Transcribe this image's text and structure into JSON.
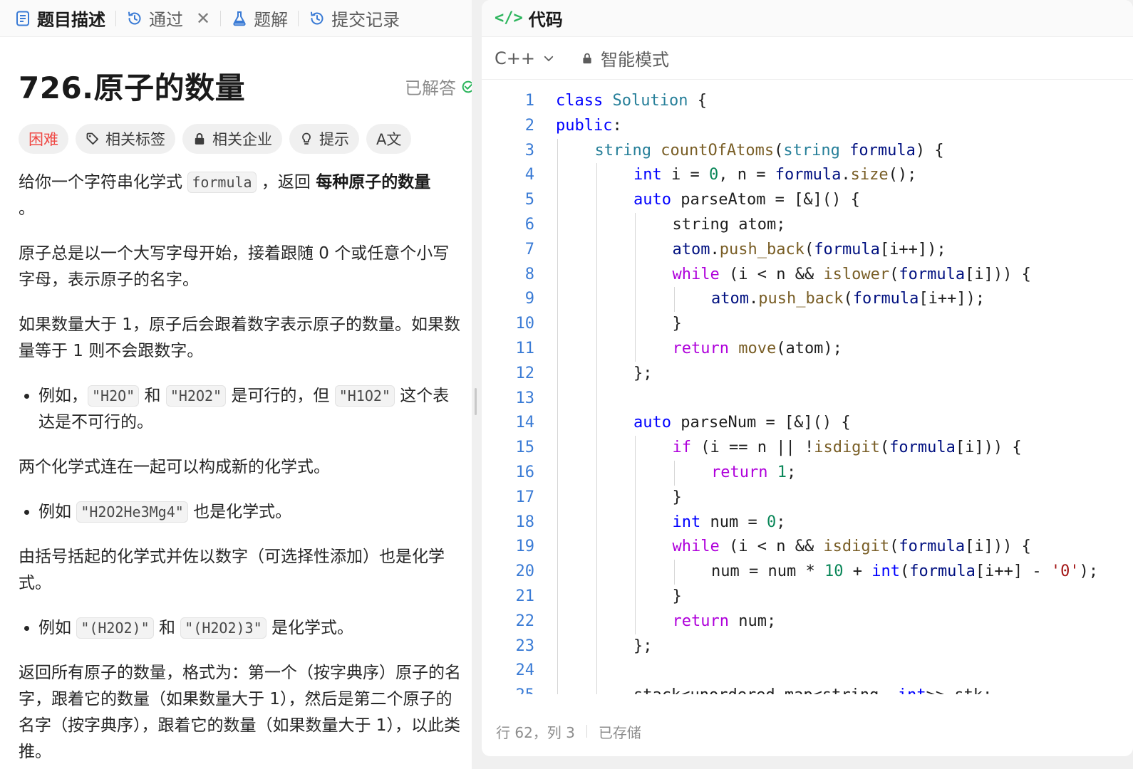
{
  "left_tabs": [
    {
      "label": "题目描述",
      "icon": "description-icon",
      "active": true
    },
    {
      "label": "通过",
      "icon": "history-icon",
      "closable": true
    },
    {
      "label": "题解",
      "icon": "flask-icon"
    },
    {
      "label": "提交记录",
      "icon": "history-icon"
    }
  ],
  "close_glyph": "✕",
  "problem": {
    "title": "726.原子的数量",
    "status": "已解答",
    "tags": [
      "困难",
      "相关标签",
      "相关企业",
      "提示",
      "A文"
    ],
    "para1_prefix": "给你一个字符串化学式 ",
    "para1_code": "formula",
    "para1_mid": " ，返回 ",
    "para1_bold": "每种原子的数量",
    "para1_end": " 。",
    "para2": "原子总是以一个大写字母开始，接着跟随 0 个或任意个小写字母，表示原子的名字。",
    "para3": "如果数量大于 1，原子后会跟着数字表示原子的数量。如果数量等于 1 则不会跟数字。",
    "bullet1_a": "例如，",
    "bullet1_code1": "\"H2O\"",
    "bullet1_b": " 和 ",
    "bullet1_code2": "\"H2O2\"",
    "bullet1_c": " 是可行的，但 ",
    "bullet1_code3": "\"H1O2\"",
    "bullet1_d": " 这个表达是不可行的。",
    "para4": "两个化学式连在一起可以构成新的化学式。",
    "bullet2_a": "例如 ",
    "bullet2_code": "\"H2O2He3Mg4\"",
    "bullet2_b": " 也是化学式。",
    "para5": "由括号括起的化学式并佐以数字（可选择性添加）也是化学式。",
    "bullet3_a": "例如 ",
    "bullet3_code1": "\"(H2O2)\"",
    "bullet3_b": " 和 ",
    "bullet3_code2": "\"(H2O2)3\"",
    "bullet3_c": " 是化学式。",
    "para6": "返回所有原子的数量，格式为：第一个（按字典序）原子的名字，跟着它的数量（如果数量大于 1），然后是第二个原子的名字（按字典序），跟着它的数量（如果数量大于 1），以此类推。"
  },
  "code_panel": {
    "icon_glyph": "</>",
    "title": "代码",
    "language": "C++",
    "mode": "智能模式",
    "status_position": "行 62，列 3",
    "status_saved": "已存储"
  },
  "code_lines": [
    {
      "n": "1",
      "indent": 0,
      "tokens": [
        [
          "kw",
          "class "
        ],
        [
          "ty",
          "Solution"
        ],
        [
          "pl",
          " {"
        ]
      ]
    },
    {
      "n": "2",
      "indent": 0,
      "tokens": [
        [
          "kw",
          "public"
        ],
        [
          "pl",
          ":"
        ]
      ]
    },
    {
      "n": "3",
      "indent": 1,
      "tokens": [
        [
          "ty",
          "string "
        ],
        [
          "fn",
          "countOfAtoms"
        ],
        [
          "pl",
          "("
        ],
        [
          "ty",
          "string "
        ],
        [
          "vr",
          "formula"
        ],
        [
          "pl",
          ") {"
        ]
      ]
    },
    {
      "n": "4",
      "indent": 2,
      "tokens": [
        [
          "kw",
          "int "
        ],
        [
          "pl",
          "i = "
        ],
        [
          "nm",
          "0"
        ],
        [
          "pl",
          ", n = "
        ],
        [
          "vr",
          "formula"
        ],
        [
          "pl",
          "."
        ],
        [
          "fn",
          "size"
        ],
        [
          "pl",
          "();"
        ]
      ]
    },
    {
      "n": "5",
      "indent": 2,
      "tokens": [
        [
          "kw",
          "auto "
        ],
        [
          "pl",
          "parseAtom = [&]() {"
        ]
      ]
    },
    {
      "n": "6",
      "indent": 3,
      "tokens": [
        [
          "pl",
          "string atom;"
        ]
      ]
    },
    {
      "n": "7",
      "indent": 3,
      "tokens": [
        [
          "vr",
          "atom"
        ],
        [
          "pl",
          "."
        ],
        [
          "fn",
          "push_back"
        ],
        [
          "pl",
          "("
        ],
        [
          "vr",
          "formula"
        ],
        [
          "pl",
          "[i++]);"
        ]
      ]
    },
    {
      "n": "8",
      "indent": 3,
      "tokens": [
        [
          "kw2",
          "while "
        ],
        [
          "pl",
          "(i < n && "
        ],
        [
          "fn",
          "islower"
        ],
        [
          "pl",
          "("
        ],
        [
          "vr",
          "formula"
        ],
        [
          "pl",
          "[i])) {"
        ]
      ]
    },
    {
      "n": "9",
      "indent": 4,
      "tokens": [
        [
          "vr",
          "atom"
        ],
        [
          "pl",
          "."
        ],
        [
          "fn",
          "push_back"
        ],
        [
          "pl",
          "("
        ],
        [
          "vr",
          "formula"
        ],
        [
          "pl",
          "[i++]);"
        ]
      ]
    },
    {
      "n": "10",
      "indent": 3,
      "tokens": [
        [
          "pl",
          "}"
        ]
      ]
    },
    {
      "n": "11",
      "indent": 3,
      "tokens": [
        [
          "kw2",
          "return "
        ],
        [
          "fn",
          "move"
        ],
        [
          "pl",
          "(atom);"
        ]
      ]
    },
    {
      "n": "12",
      "indent": 2,
      "tokens": [
        [
          "pl",
          "};"
        ]
      ]
    },
    {
      "n": "13",
      "indent": 0,
      "tokens": []
    },
    {
      "n": "14",
      "indent": 2,
      "tokens": [
        [
          "kw",
          "auto "
        ],
        [
          "pl",
          "parseNum = [&]() {"
        ]
      ]
    },
    {
      "n": "15",
      "indent": 3,
      "tokens": [
        [
          "kw2",
          "if "
        ],
        [
          "pl",
          "(i == n || !"
        ],
        [
          "fn",
          "isdigit"
        ],
        [
          "pl",
          "("
        ],
        [
          "vr",
          "formula"
        ],
        [
          "pl",
          "[i])) {"
        ]
      ]
    },
    {
      "n": "16",
      "indent": 4,
      "tokens": [
        [
          "kw2",
          "return "
        ],
        [
          "nm",
          "1"
        ],
        [
          "pl",
          ";"
        ]
      ]
    },
    {
      "n": "17",
      "indent": 3,
      "tokens": [
        [
          "pl",
          "}"
        ]
      ]
    },
    {
      "n": "18",
      "indent": 3,
      "tokens": [
        [
          "kw",
          "int "
        ],
        [
          "pl",
          "num = "
        ],
        [
          "nm",
          "0"
        ],
        [
          "pl",
          ";"
        ]
      ]
    },
    {
      "n": "19",
      "indent": 3,
      "tokens": [
        [
          "kw2",
          "while "
        ],
        [
          "pl",
          "(i < n && "
        ],
        [
          "fn",
          "isdigit"
        ],
        [
          "pl",
          "("
        ],
        [
          "vr",
          "formula"
        ],
        [
          "pl",
          "[i])) {"
        ]
      ]
    },
    {
      "n": "20",
      "indent": 4,
      "tokens": [
        [
          "pl",
          "num = num * "
        ],
        [
          "nm",
          "10"
        ],
        [
          "pl",
          " + "
        ],
        [
          "kw",
          "int"
        ],
        [
          "pl",
          "("
        ],
        [
          "vr",
          "formula"
        ],
        [
          "pl",
          "[i++] - "
        ],
        [
          "st",
          "'0'"
        ],
        [
          "pl",
          ");"
        ]
      ]
    },
    {
      "n": "21",
      "indent": 3,
      "tokens": [
        [
          "pl",
          "}"
        ]
      ]
    },
    {
      "n": "22",
      "indent": 3,
      "tokens": [
        [
          "kw2",
          "return "
        ],
        [
          "pl",
          "num;"
        ]
      ]
    },
    {
      "n": "23",
      "indent": 2,
      "tokens": [
        [
          "pl",
          "};"
        ]
      ]
    },
    {
      "n": "24",
      "indent": 0,
      "tokens": []
    },
    {
      "n": "25",
      "indent": 2,
      "tokens": [
        [
          "pl",
          "stack<unordered_map<string, "
        ],
        [
          "kw",
          "int"
        ],
        [
          "pl",
          ">> stk;"
        ]
      ]
    }
  ]
}
